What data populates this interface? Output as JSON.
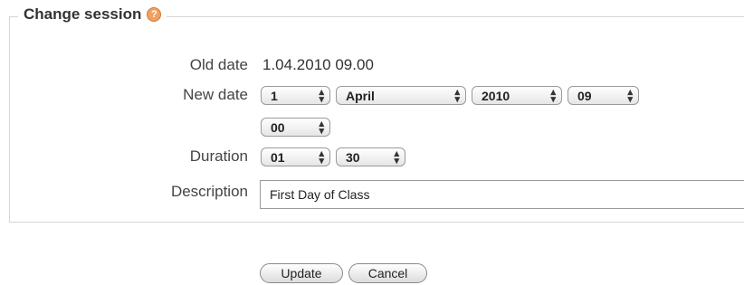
{
  "form": {
    "legend": "Change session",
    "old_date_label": "Old date",
    "old_date_value": "1.04.2010 09.00",
    "new_date_label": "New date",
    "new_date": {
      "day": "1",
      "month": "April",
      "year": "2010",
      "hour": "09",
      "minute": "00"
    },
    "duration_label": "Duration",
    "duration": {
      "hours": "01",
      "minutes": "30"
    },
    "description_label": "Description",
    "description_value": "First Day of Class"
  },
  "buttons": {
    "update": "Update",
    "cancel": "Cancel"
  },
  "colors": {
    "help_icon": "#f0a060",
    "border": "#d6d6d6"
  }
}
